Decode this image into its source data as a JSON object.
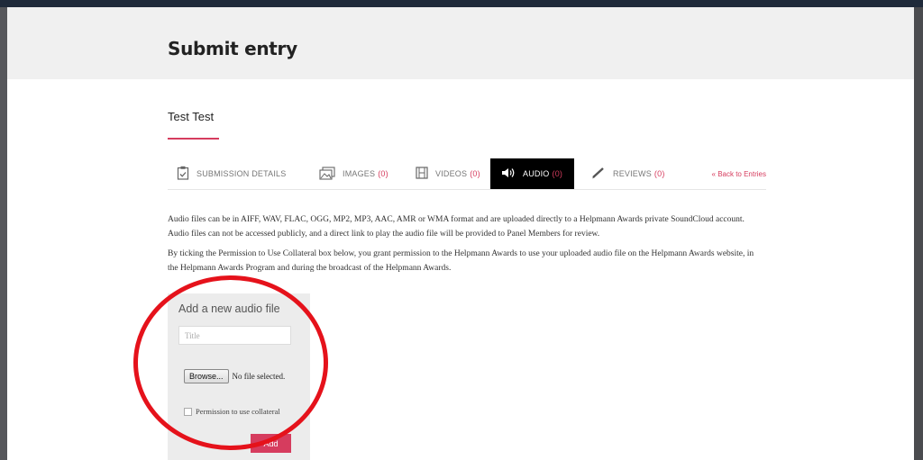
{
  "page": {
    "title": "Submit entry",
    "entry_name": "Test Test"
  },
  "tabs": [
    {
      "label": "SUBMISSION DETAILS",
      "count": "",
      "icon": "clipboard-icon"
    },
    {
      "label": "IMAGES",
      "count": "(0)",
      "icon": "images-icon"
    },
    {
      "label": "VIDEOS",
      "count": "(0)",
      "icon": "film-icon"
    },
    {
      "label": "AUDIO",
      "count": "(0)",
      "icon": "speaker-icon",
      "active": true
    },
    {
      "label": "REVIEWS",
      "count": "(0)",
      "icon": "pen-icon"
    }
  ],
  "back_link": "« Back to Entries",
  "description": {
    "p1": "Audio files can be in AIFF, WAV, FLAC, OGG, MP2, MP3, AAC, AMR or WMA format and are uploaded directly to a Helpmann Awards private SoundCloud account. Audio files can not be accessed publicly, and a direct link to play the audio file will be provided to Panel Members for review.",
    "p2": "By ticking the Permission to Use Collateral box below, you grant permission to the Helpmann Awards to use your uploaded audio file on the Helpmann Awards website, in the Helpmann Awards Program and during the broadcast of the Helpmann Awards."
  },
  "upload_form": {
    "heading": "Add a new audio file",
    "title_placeholder": "Title",
    "browse_label": "Browse...",
    "file_status": "No file selected.",
    "permission_label": "Permission to use collateral",
    "add_label": "Add"
  },
  "colors": {
    "accent": "#d63c5e",
    "annotation": "#e5121b"
  }
}
